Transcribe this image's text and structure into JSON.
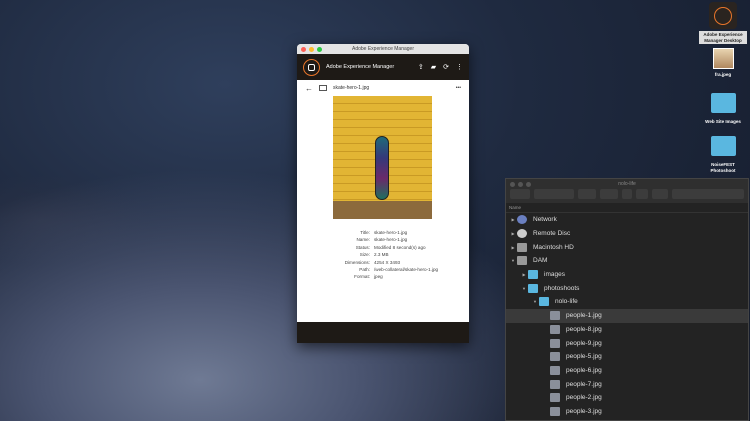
{
  "aem_window": {
    "title": "Adobe Experience Manager",
    "app_name": "Adobe Experience Manager",
    "file_name": "skate-hero-1.jpg",
    "metadata": [
      {
        "key": "Title:",
        "value": "skate-hero-1.jpg"
      },
      {
        "key": "Name:",
        "value": "skate-hero-1.jpg"
      },
      {
        "key": "Status:",
        "value": "Modified 8 second(s) ago"
      },
      {
        "key": "Size:",
        "value": "2.3 MB"
      },
      {
        "key": "Dimensions:",
        "value": "4254 X 3493"
      },
      {
        "key": "Path:",
        "value": "/web-collateral/skate-hero-1.jpg"
      },
      {
        "key": "Format:",
        "value": "jpeg"
      }
    ],
    "accent": "#e8752a"
  },
  "finder": {
    "title": "nolo-life",
    "column_header": "Name",
    "items": [
      {
        "label": "Network",
        "type": "network",
        "level": 0
      },
      {
        "label": "Remote Disc",
        "type": "disc",
        "level": 0
      },
      {
        "label": "Macintosh HD",
        "type": "drive",
        "level": 0
      },
      {
        "label": "DAM",
        "type": "drive",
        "level": 0,
        "expanded": true
      },
      {
        "label": "images",
        "type": "folder",
        "level": 1
      },
      {
        "label": "photoshoots",
        "type": "folder",
        "level": 1,
        "expanded": true
      },
      {
        "label": "nolo-life",
        "type": "folder",
        "level": 2,
        "expanded": true
      },
      {
        "label": "people-1.jpg",
        "type": "image",
        "level": 3,
        "selected": true
      },
      {
        "label": "people-8.jpg",
        "type": "image",
        "level": 3
      },
      {
        "label": "people-9.jpg",
        "type": "image",
        "level": 3
      },
      {
        "label": "people-5.jpg",
        "type": "image",
        "level": 3
      },
      {
        "label": "people-6.jpg",
        "type": "image",
        "level": 3
      },
      {
        "label": "people-7.jpg",
        "type": "image",
        "level": 3
      },
      {
        "label": "people-2.jpg",
        "type": "image",
        "level": 3
      },
      {
        "label": "people-3.jpg",
        "type": "image",
        "level": 3
      }
    ]
  },
  "desktop": {
    "icons": [
      {
        "label": "Adobe Experience Manager Desktop"
      },
      {
        "label": "fra.jpeg"
      },
      {
        "label": "Web Site Images"
      },
      {
        "label": "NoiseFEST Photoshoot"
      }
    ]
  }
}
